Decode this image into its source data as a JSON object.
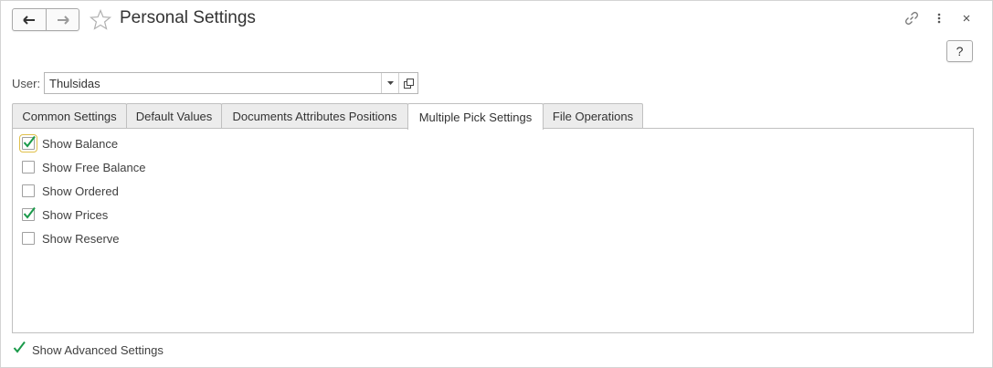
{
  "window": {
    "title": "Personal Settings"
  },
  "toolbar": {
    "help_label": "?"
  },
  "user": {
    "label": "User:",
    "value": "Thulsidas"
  },
  "tabs": [
    {
      "label": "Common Settings",
      "active": false
    },
    {
      "label": "Default Values",
      "active": false
    },
    {
      "label": "Documents Attributes Positions",
      "active": false
    },
    {
      "label": "Multiple Pick Settings",
      "active": true
    },
    {
      "label": "File Operations",
      "active": false
    }
  ],
  "options": [
    {
      "label": "Show Balance",
      "checked": true
    },
    {
      "label": "Show Free Balance",
      "checked": false
    },
    {
      "label": "Show Ordered",
      "checked": false
    },
    {
      "label": "Show Prices",
      "checked": true
    },
    {
      "label": "Show Reserve",
      "checked": false
    }
  ],
  "advanced": {
    "label": "Show Advanced Settings",
    "checked": true
  },
  "colors": {
    "check": "#1a9a4a",
    "focus": "#e0c04a",
    "border": "#c0c0c0"
  }
}
